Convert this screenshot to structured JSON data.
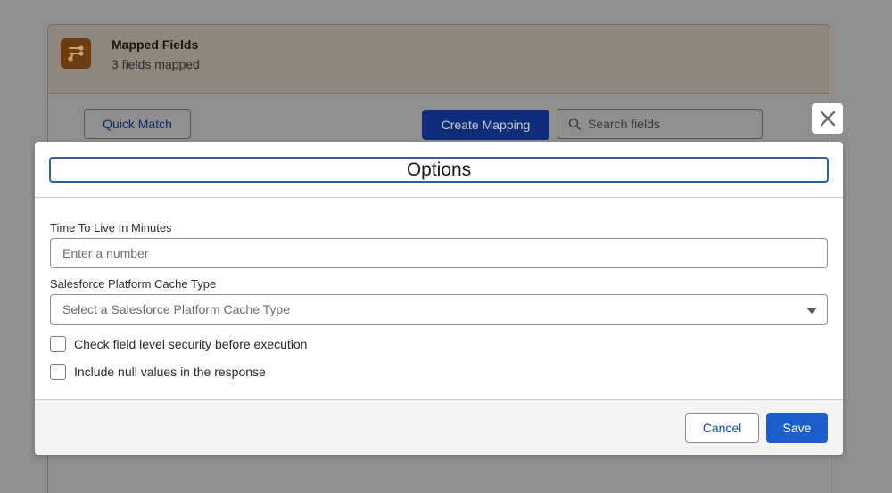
{
  "background": {
    "card": {
      "title": "Mapped Fields",
      "subtitle": "3 fields mapped",
      "icon": "mapping-icon"
    },
    "toolbar": {
      "quick_match_label": "Quick Match",
      "create_mapping_label": "Create Mapping",
      "search_placeholder": "Search fields"
    }
  },
  "modal": {
    "close_icon": "close-icon",
    "title": "Options",
    "fields": {
      "ttl_label": "Time To Live In Minutes",
      "ttl_placeholder": "Enter a number",
      "ttl_value": "",
      "cache_type_label": "Salesforce Platform Cache Type",
      "cache_type_placeholder": "Select a Salesforce Platform Cache Type"
    },
    "checkboxes": [
      {
        "label": "Check field level security before execution",
        "checked": false
      },
      {
        "label": "Include null values in the response",
        "checked": false
      }
    ],
    "footer": {
      "cancel_label": "Cancel",
      "save_label": "Save"
    }
  },
  "colors": {
    "brand_blue": "#1b5dc9",
    "focus_border": "#2c5fa8",
    "overlay": "#8f8f8f"
  }
}
